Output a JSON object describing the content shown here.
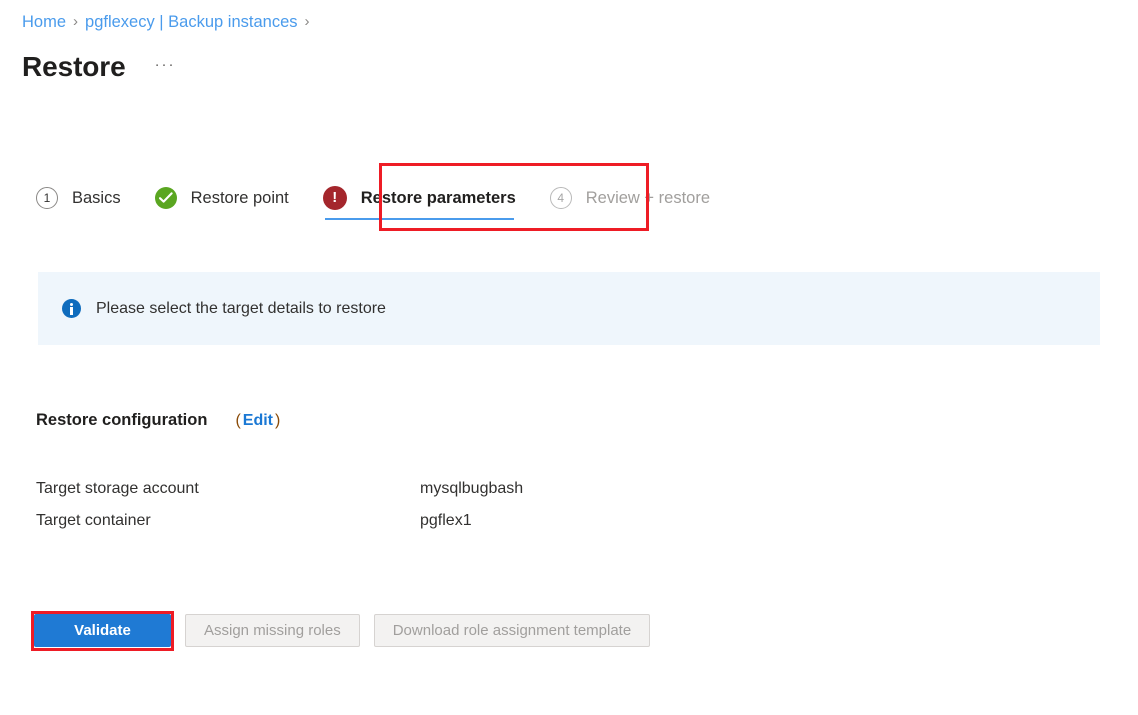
{
  "breadcrumb": {
    "separator": "›",
    "items": [
      {
        "label": "Home"
      },
      {
        "label": "pgflexecy | Backup instances"
      }
    ]
  },
  "header": {
    "title": "Restore",
    "ellipsis": "···"
  },
  "wizard": {
    "steps": [
      {
        "label": "Basics",
        "marker": "1",
        "state": "todo"
      },
      {
        "label": "Restore point",
        "marker": "check-icon",
        "state": "complete"
      },
      {
        "label": "Restore parameters",
        "marker": "error-icon",
        "state": "active-error"
      },
      {
        "label": "Review + restore",
        "marker": "4",
        "state": "disabled"
      }
    ]
  },
  "banner": {
    "icon": "info-icon",
    "message": "Please select the target details to restore",
    "background": "#eff6fc",
    "icon_color": "#0f6cbd"
  },
  "restore_configuration": {
    "title": "Restore configuration",
    "edit_open_paren": "(",
    "edit_label": "Edit",
    "edit_close_paren": ")",
    "rows": [
      {
        "key": "Target storage account",
        "value": "mysqlbugbash"
      },
      {
        "key": "Target container",
        "value": "pgflex1"
      }
    ]
  },
  "actions": {
    "buttons": [
      {
        "label": "Validate",
        "style": "primary",
        "enabled": true
      },
      {
        "label": "Assign missing roles",
        "style": "disabled",
        "enabled": false
      },
      {
        "label": "Download role assignment template",
        "style": "disabled",
        "enabled": false
      }
    ]
  },
  "annotations": {
    "color": "#ee1c25",
    "targets": [
      "restore-parameters-tab",
      "validate-button"
    ]
  },
  "colors": {
    "link": "#4a9bec",
    "primary": "#1f7ad4",
    "success": "#5aa621",
    "error": "#a4262c",
    "disabled_text": "#a19f9d"
  }
}
